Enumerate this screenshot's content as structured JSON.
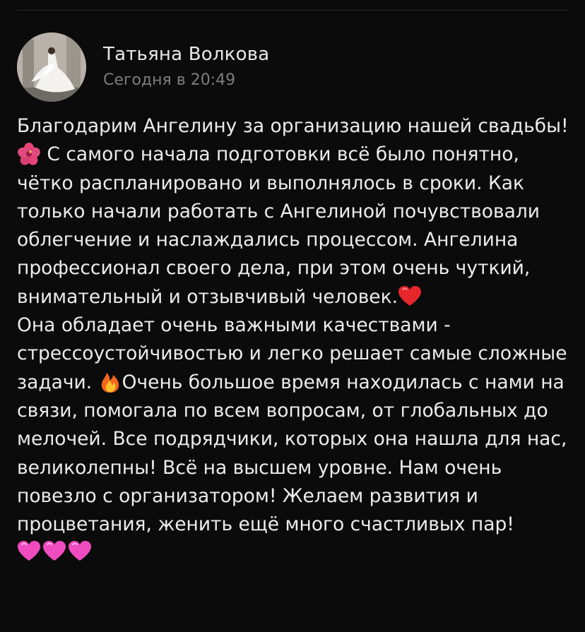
{
  "post": {
    "author": "Татьяна Волкова",
    "time": "Сегодня в 20:49",
    "text_part_1": "Благодарим Ангелину за организацию нашей свадьбы! ",
    "text_part_2": " С самого начала подготовки всё было понятно, чётко распланировано и выполнялось в сроки. Как только начали работать с Ангелиной почувствовали облегчение и наслаждались процессом. Ангелина профессионал своего дела, при этом очень чуткий, внимательный и отзывчивый человек.",
    "text_part_3": "Она обладает очень важными качествами - стрессоустойчивостью и легко решает самые сложные задачи. ",
    "text_part_4": "Очень большое время находилась с нами на связи, помогала по всем вопросам, от глобальных до мелочей. Все подрядчики, которых она нашла для нас, великолепны! Всё на высшем уровне. Нам очень повезло с организатором! Желаем развития и процветания, женить ещё много счастливых пар!",
    "emojis": {
      "first": "hibiscus-emoji",
      "second": "red-heart-emoji",
      "third": "fire-emoji",
      "trailing": [
        "pink-heart-emoji",
        "pink-heart-emoji",
        "pink-heart-emoji"
      ]
    }
  },
  "colors": {
    "background": "#0b0b0b",
    "text": "#ececec",
    "time": "#7d7d7d"
  }
}
